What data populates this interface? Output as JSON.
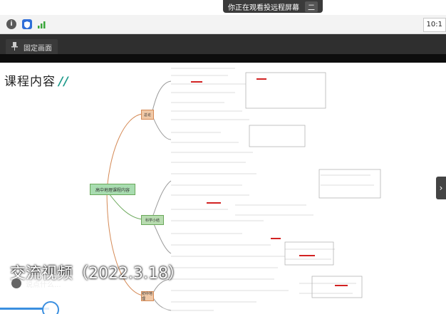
{
  "toast": {
    "text": "你正在观看投远程屏幕",
    "exit_label": "二"
  },
  "toolbar": {
    "time": "10:1",
    "info_glyph": "i"
  },
  "video": {
    "pin_label": "固定画面",
    "right_arrow": "›",
    "caption": "交流视频（2022.3.18）",
    "chat_placeholder": "说点什么...",
    "progress": 0.11
  },
  "slide": {
    "title": "课程内容",
    "title_mark": "//",
    "center_node": "高中地理课程内容",
    "branches": [
      {
        "label": "总论",
        "color": "#f0c8a6"
      },
      {
        "label": "科学小结",
        "color": "#b8dcb0"
      },
      {
        "label": "初中地理",
        "color": "#f0c8a6"
      }
    ],
    "colors": {
      "accent": "#1c9a8a",
      "center": "#a8dcb0",
      "red": "#d22222"
    }
  }
}
